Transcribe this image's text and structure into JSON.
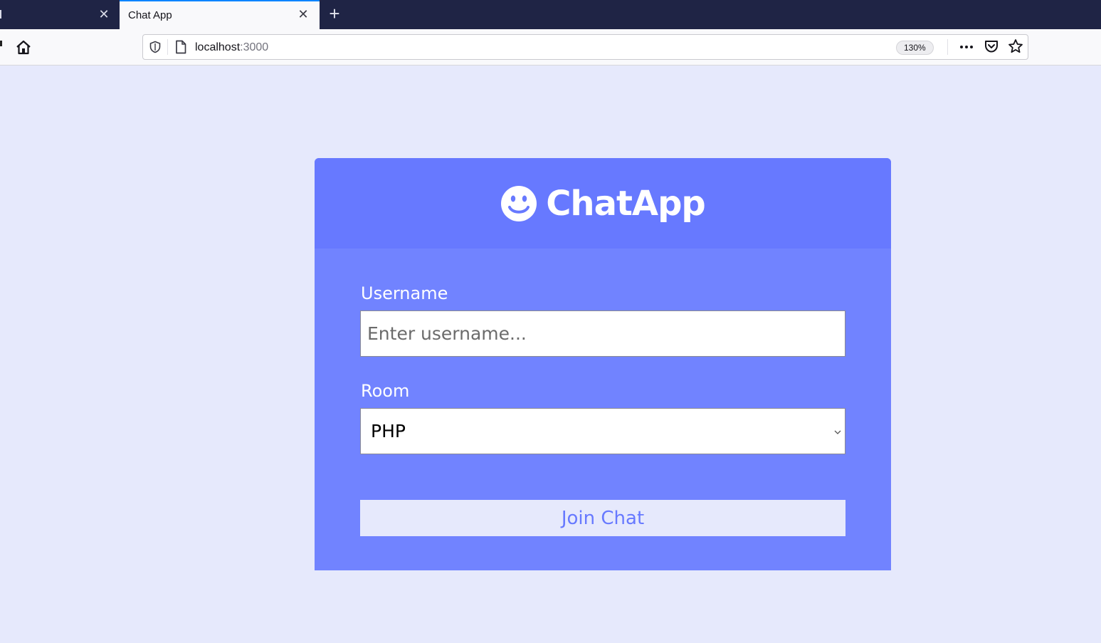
{
  "browser": {
    "tabs": [
      {
        "label": ":"
      },
      {
        "label": "Chat App",
        "active": true
      }
    ],
    "url_host": "localhost",
    "url_port": ":3000",
    "zoom": "130%",
    "accent_color": "#0a84ff"
  },
  "app": {
    "brand_icon": "smile-icon",
    "title": "ChatApp",
    "header_color": "#6779ff",
    "body_color": "#7183ff",
    "background_color": "#e6e9fc"
  },
  "form": {
    "username_label": "Username",
    "username_placeholder": "Enter username...",
    "username_value": "",
    "room_label": "Room",
    "room_selected": "PHP",
    "join_label": "Join Chat"
  }
}
